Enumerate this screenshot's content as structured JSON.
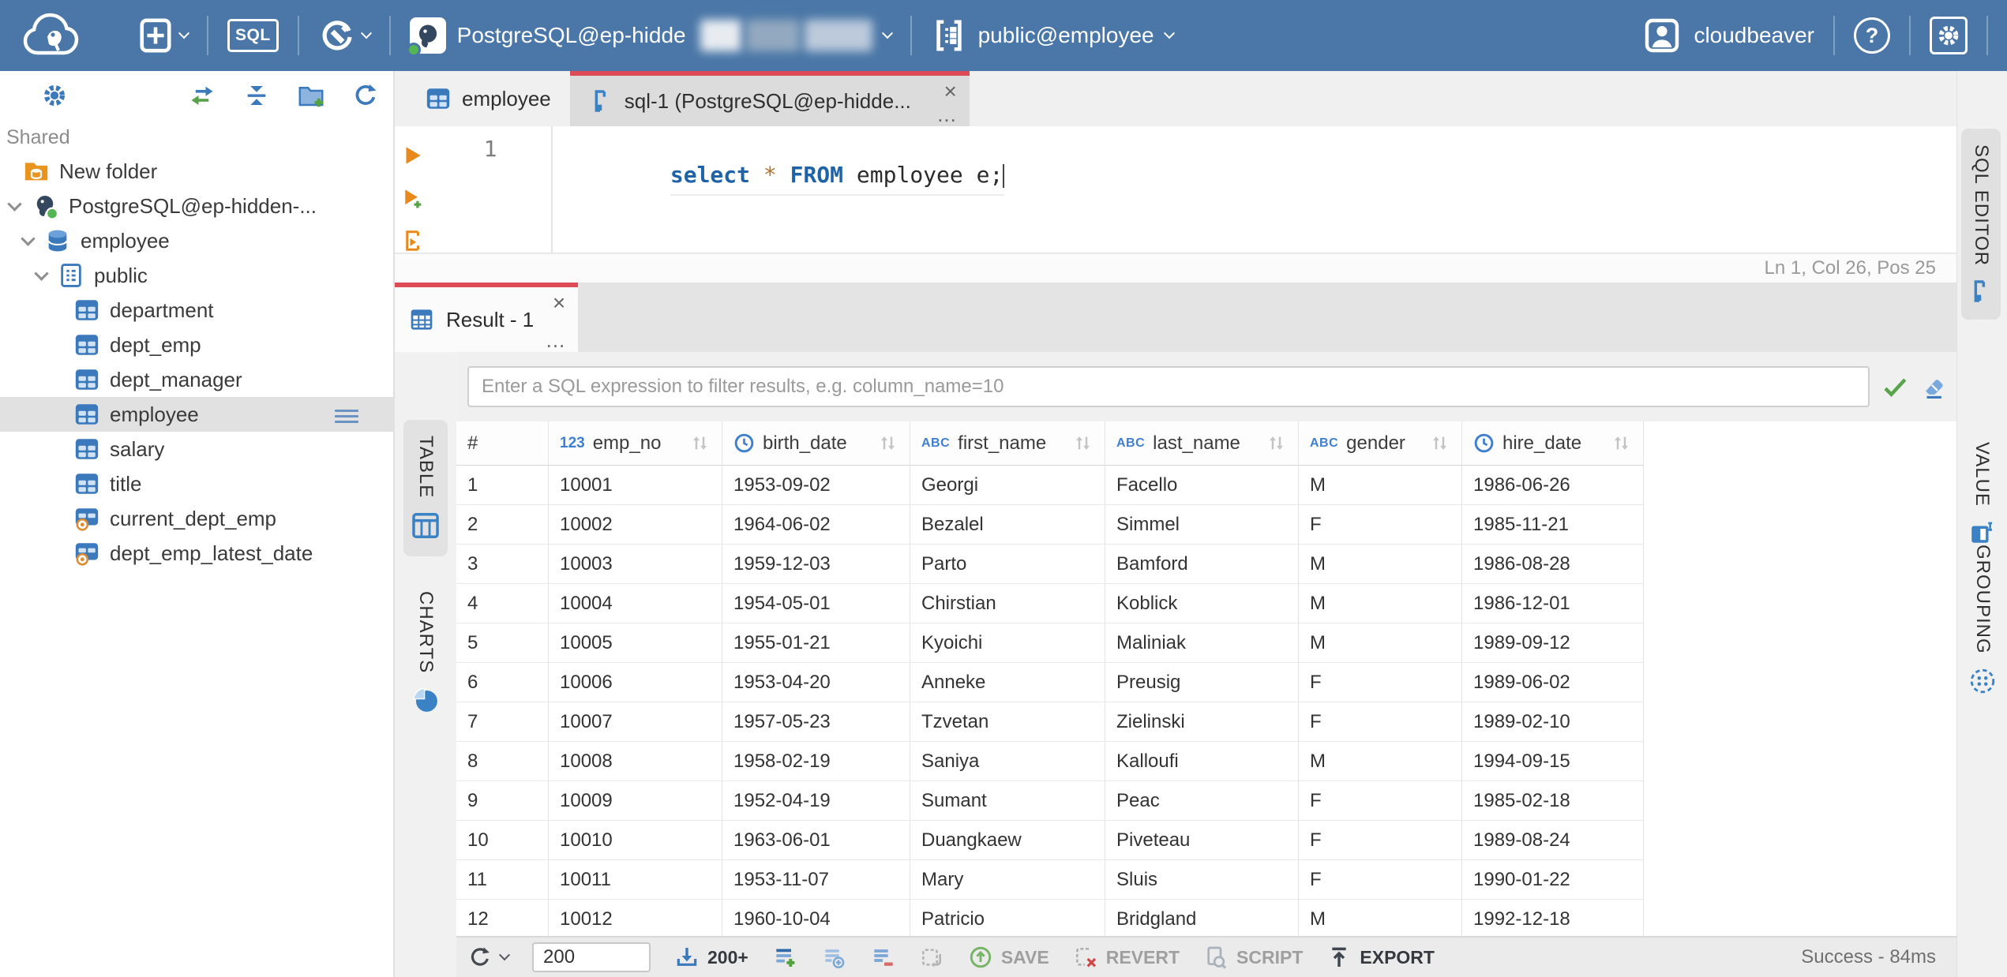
{
  "topbar": {
    "sql_badge": "SQL",
    "connection_name": "PostgreSQL@ep-hidde",
    "schema_selector": "public@employee",
    "username": "cloudbeaver",
    "help_glyph": "?"
  },
  "sidebar": {
    "section_label": "Shared",
    "tree": [
      {
        "label": "New folder",
        "icon": "folder-db",
        "level": 1,
        "chevron": false,
        "spacer": false,
        "selected": false
      },
      {
        "label": "PostgreSQL@ep-hidden-...",
        "icon": "postgres",
        "level": 0,
        "chevron": true,
        "spacer": false,
        "selected": false
      },
      {
        "label": "employee",
        "icon": "database",
        "level": 1,
        "chevron": true,
        "spacer": false,
        "selected": false
      },
      {
        "label": "public",
        "icon": "schema",
        "level": 2,
        "chevron": true,
        "spacer": false,
        "selected": false
      },
      {
        "label": "department",
        "icon": "table",
        "level": 3,
        "chevron": false,
        "spacer": true,
        "selected": false
      },
      {
        "label": "dept_emp",
        "icon": "table",
        "level": 3,
        "chevron": false,
        "spacer": true,
        "selected": false
      },
      {
        "label": "dept_manager",
        "icon": "table",
        "level": 3,
        "chevron": false,
        "spacer": true,
        "selected": false
      },
      {
        "label": "employee",
        "icon": "table",
        "level": 3,
        "chevron": false,
        "spacer": true,
        "selected": true
      },
      {
        "label": "salary",
        "icon": "table",
        "level": 3,
        "chevron": false,
        "spacer": true,
        "selected": false
      },
      {
        "label": "title",
        "icon": "table",
        "level": 3,
        "chevron": false,
        "spacer": true,
        "selected": false
      },
      {
        "label": "current_dept_emp",
        "icon": "view",
        "level": 3,
        "chevron": false,
        "spacer": true,
        "selected": false
      },
      {
        "label": "dept_emp_latest_date",
        "icon": "view",
        "level": 3,
        "chevron": false,
        "spacer": true,
        "selected": false
      }
    ]
  },
  "editor": {
    "tabs": [
      {
        "label": "employee",
        "icon": "table",
        "active": false
      },
      {
        "label": "sql-1 (PostgreSQL@ep-hidde...",
        "icon": "sql-script",
        "active": true
      }
    ],
    "line_number": "1",
    "code_tokens": [
      {
        "text": "select",
        "type": "kw"
      },
      {
        "text": " ",
        "type": "plain"
      },
      {
        "text": "*",
        "type": "star"
      },
      {
        "text": " ",
        "type": "plain"
      },
      {
        "text": "FROM",
        "type": "kw"
      },
      {
        "text": " employee e;",
        "type": "plain"
      }
    ],
    "status": "Ln 1, Col 26, Pos 25",
    "vertical_tab": "SQL EDITOR"
  },
  "result": {
    "tab_label": "Result - 1",
    "close_glyph": "×",
    "dots_glyph": "...",
    "filter_placeholder": "Enter a SQL expression to filter results, e.g. column_name=10",
    "left_tabs": [
      {
        "label": "TABLE",
        "icon": "table-outline",
        "active": true
      },
      {
        "label": "CHARTS",
        "icon": "pie",
        "active": false
      }
    ],
    "right_tabs": [
      {
        "label": "VALUE",
        "icon": "value-panel"
      },
      {
        "label": "GROUPING",
        "icon": "grouping"
      }
    ],
    "grid": {
      "row_header": "#",
      "columns": [
        {
          "name": "emp_no",
          "type": "123"
        },
        {
          "name": "birth_date",
          "type": "clock"
        },
        {
          "name": "first_name",
          "type": "abc"
        },
        {
          "name": "last_name",
          "type": "abc"
        },
        {
          "name": "gender",
          "type": "abc"
        },
        {
          "name": "hire_date",
          "type": "clock"
        }
      ],
      "rows": [
        [
          "1",
          "10001",
          "1953-09-02",
          "Georgi",
          "Facello",
          "M",
          "1986-06-26"
        ],
        [
          "2",
          "10002",
          "1964-06-02",
          "Bezalel",
          "Simmel",
          "F",
          "1985-11-21"
        ],
        [
          "3",
          "10003",
          "1959-12-03",
          "Parto",
          "Bamford",
          "M",
          "1986-08-28"
        ],
        [
          "4",
          "10004",
          "1954-05-01",
          "Chirstian",
          "Koblick",
          "M",
          "1986-12-01"
        ],
        [
          "5",
          "10005",
          "1955-01-21",
          "Kyoichi",
          "Maliniak",
          "M",
          "1989-09-12"
        ],
        [
          "6",
          "10006",
          "1953-04-20",
          "Anneke",
          "Preusig",
          "F",
          "1989-06-02"
        ],
        [
          "7",
          "10007",
          "1957-05-23",
          "Tzvetan",
          "Zielinski",
          "F",
          "1989-02-10"
        ],
        [
          "8",
          "10008",
          "1958-02-19",
          "Saniya",
          "Kalloufi",
          "M",
          "1994-09-15"
        ],
        [
          "9",
          "10009",
          "1952-04-19",
          "Sumant",
          "Peac",
          "F",
          "1985-02-18"
        ],
        [
          "10",
          "10010",
          "1963-06-01",
          "Duangkaew",
          "Piveteau",
          "F",
          "1989-08-24"
        ],
        [
          "11",
          "10011",
          "1953-11-07",
          "Mary",
          "Sluis",
          "F",
          "1990-01-22"
        ],
        [
          "12",
          "10012",
          "1960-10-04",
          "Patricio",
          "Bridgland",
          "M",
          "1992-12-18"
        ]
      ]
    },
    "toolbar": {
      "row_limit": "200",
      "fetch_label": "200+",
      "save_label": "SAVE",
      "revert_label": "REVERT",
      "script_label": "SCRIPT",
      "export_label": "EXPORT",
      "status": "Success - 84ms"
    }
  },
  "colors": {
    "topbar_blue": "#4a77a7",
    "accent_red": "#dd4c56",
    "icon_blue": "#3b79bd",
    "success_green": "#58a44c"
  }
}
